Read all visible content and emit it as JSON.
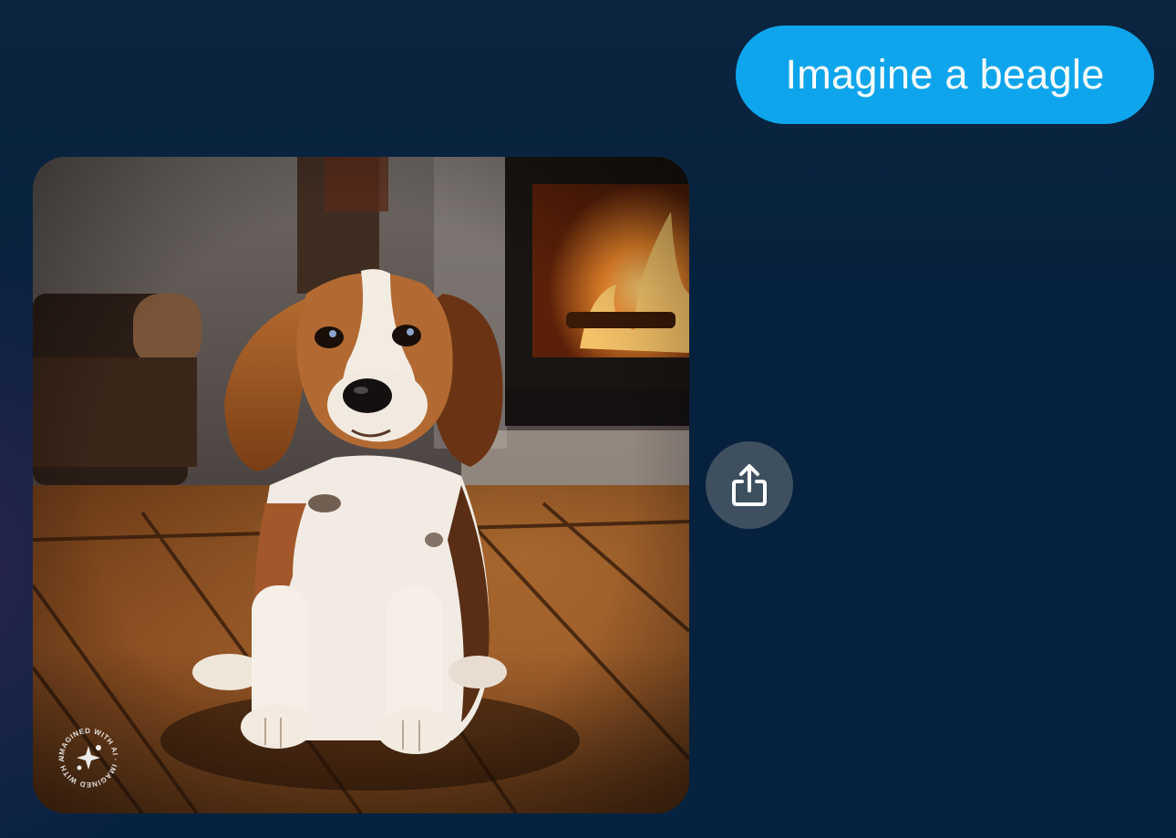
{
  "chat": {
    "user_message": "Imagine a beagle",
    "generated_image": {
      "subject": "beagle",
      "watermark_text": "IMAGINED WITH AI · IMAGINED WITH AI ·"
    },
    "share_button": {
      "icon": "share-icon"
    }
  },
  "colors": {
    "background": "#06213d",
    "user_bubble": "#0ea5ec",
    "share_button": "#3e4f60"
  }
}
